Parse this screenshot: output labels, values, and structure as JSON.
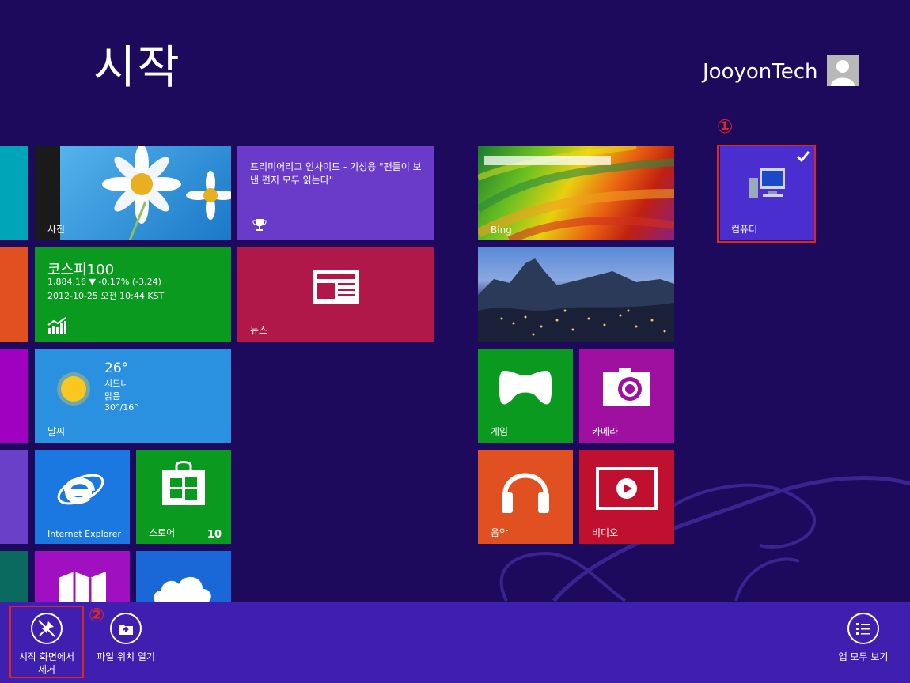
{
  "header": {
    "title": "시작",
    "user_name": "JooyonTech"
  },
  "tiles": {
    "photos": {
      "label": "사진"
    },
    "news_feed": {
      "headline": "프리미어리그 인사이드 - 기성용 \"팬들이 보낸 편지 모두 읽는다\""
    },
    "finance": {
      "index": "코스피100",
      "line1": "1,884.16  ▼ -0.17% (-3.24)",
      "line2": "2012-10-25 오전 10:44 KST"
    },
    "news": {
      "label": "뉴스"
    },
    "weather": {
      "temp": "26°",
      "city": "시드니",
      "condition": "맑음",
      "range": "30°/16°",
      "label": "날씨"
    },
    "ie": {
      "label": "Internet Explorer"
    },
    "store": {
      "label": "스토어",
      "count": "10"
    },
    "bing": {
      "label": "Bing"
    },
    "games": {
      "label": "게임"
    },
    "camera": {
      "label": "카메라"
    },
    "music": {
      "label": "음악"
    },
    "video": {
      "label": "비디오"
    },
    "computer": {
      "label": "컴퓨터",
      "selected": true
    }
  },
  "markers": {
    "one": "①",
    "two": "②"
  },
  "appbar": {
    "unpin_line1": "시작 화면에서",
    "unpin_line2": "제거",
    "open_location": "파일 위치 열기",
    "all_apps": "앱 모두 보기"
  },
  "colors": {
    "background": "#1d0a5c",
    "appbar": "#3e1fb0",
    "highlight": "#e02424"
  }
}
